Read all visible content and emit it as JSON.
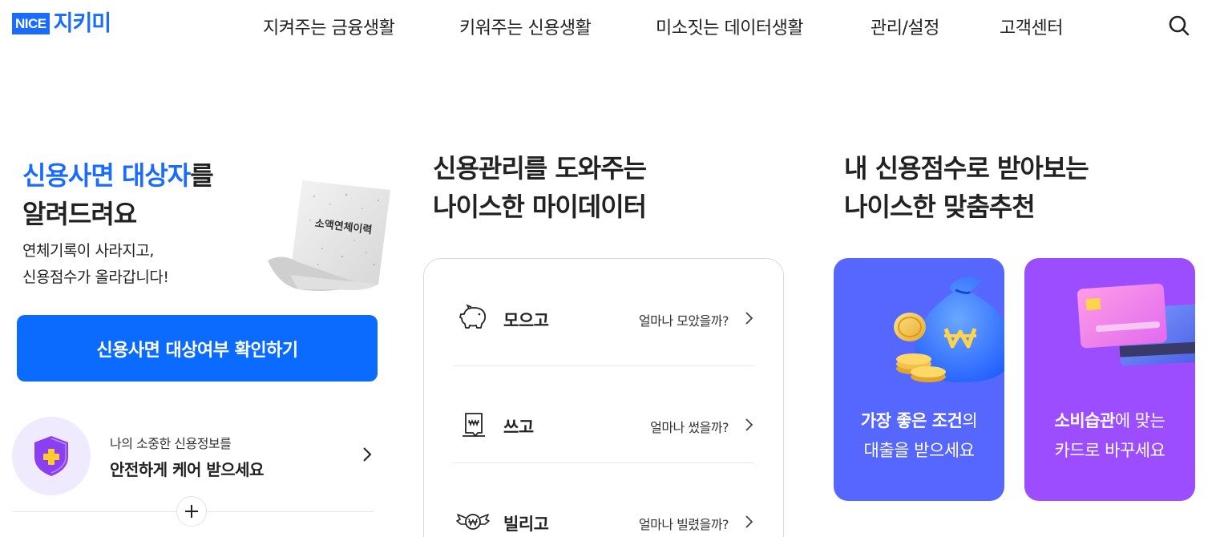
{
  "header": {
    "logo_brand": "NICE",
    "logo_name": "지키미",
    "nav": [
      "지켜주는 금융생활",
      "키워주는 신용생활",
      "미소짓는 데이터생활",
      "관리/설정",
      "고객센터"
    ]
  },
  "left": {
    "title_blue": "신용사면 대상자",
    "title_rest": "를",
    "title_line2": "알려드려요",
    "sub_line1": "연체기록이 사라지고,",
    "sub_line2": "신용점수가 올라갑니다!",
    "receipt_label": "소액연체이력",
    "cta_label": "신용사면 대상여부 확인하기",
    "care_small": "나의 소중한 신용정보를",
    "care_big": "안전하게 케어 받으세요"
  },
  "middle": {
    "title_line1": "신용관리를 도와주는",
    "title_line2": "나이스한 마이데이터",
    "rows": [
      {
        "label": "모으고",
        "question": "얼마나 모았을까?",
        "icon": "piggy-bank-icon"
      },
      {
        "label": "쓰고",
        "question": "얼마나 썼을까?",
        "icon": "receipt-icon"
      },
      {
        "label": "빌리고",
        "question": "얼마나 빌렸을까?",
        "icon": "winged-won-icon"
      }
    ]
  },
  "right": {
    "title_line1": "내 신용점수로 받아보는",
    "title_line2": "나이스한 맞춤추천",
    "loan_bold": "가장 좋은 조건",
    "loan_rest": "의",
    "loan_line2": "대출을 받으세요",
    "card_bold": "소비습관",
    "card_rest": "에 맞는",
    "card_line2": "카드로 바꾸세요"
  },
  "colors": {
    "brand_blue": "#1a6cff",
    "cta_blue": "#0b6bff",
    "loan_card_bg": "#5567ff",
    "credit_card_bg": "#9b4dff",
    "care_circle": "#efeafd"
  }
}
